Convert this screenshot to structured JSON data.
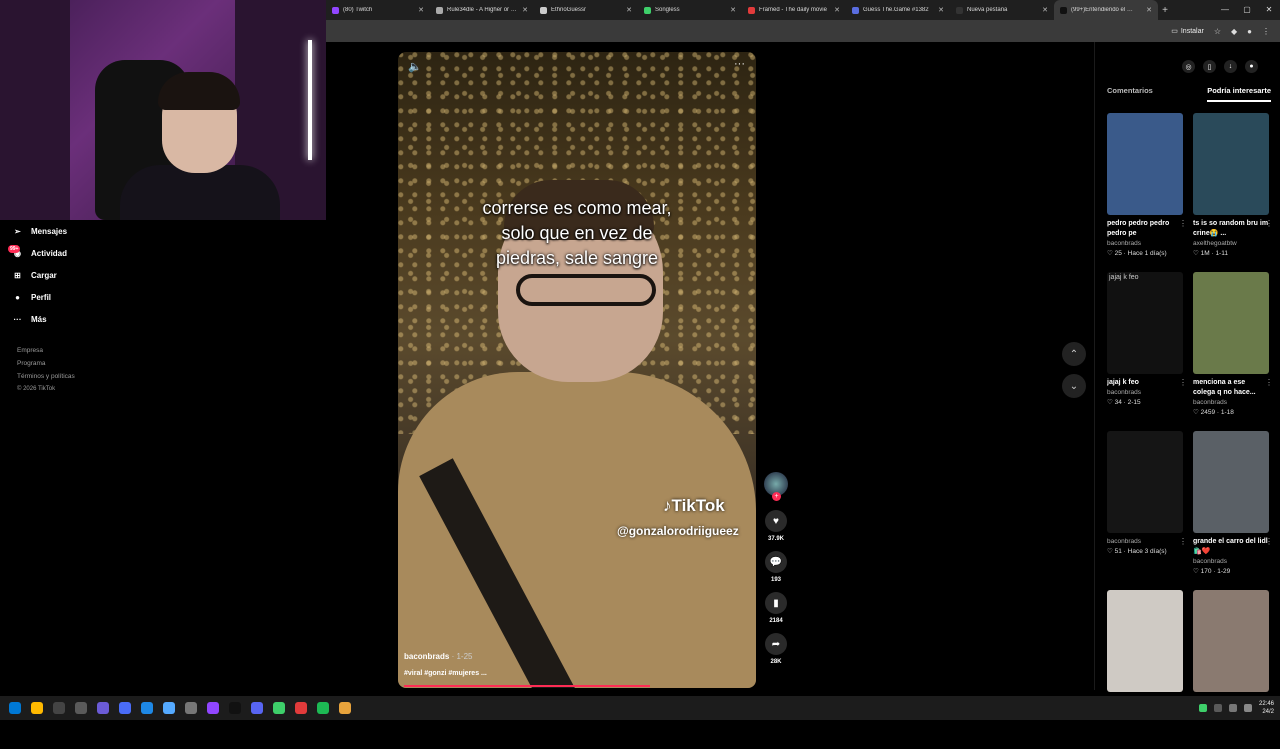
{
  "browser": {
    "tabs": [
      {
        "title": "(80) Twitch",
        "color": "#9146ff",
        "active": false
      },
      {
        "title": "Rule34dle - A Higher or Lower",
        "color": "#aaaaaa",
        "active": false
      },
      {
        "title": "EthnoGuessr",
        "color": "#cccccc",
        "active": false
      },
      {
        "title": "Songless",
        "color": "#3ecf6a",
        "active": false
      },
      {
        "title": "Framed - The daily movie",
        "color": "#e23b3b",
        "active": false
      },
      {
        "title": "Guess The.Game #1382",
        "color": "#5a6de0",
        "active": false
      },
      {
        "title": "Nueva pestaña",
        "color": "#333333",
        "active": false
      },
      {
        "title": "(99+)Entendiendo el …",
        "color": "#111111",
        "active": true
      }
    ],
    "new_tab": "+",
    "install_label": "Instalar"
  },
  "sidebar": {
    "items": [
      {
        "label": "Mensajes",
        "icon": "send-icon"
      },
      {
        "label": "Actividad",
        "icon": "bell-icon",
        "badge": "99+"
      },
      {
        "label": "Cargar",
        "icon": "plus-box-icon"
      },
      {
        "label": "Perfil",
        "icon": "avatar-icon"
      },
      {
        "label": "Más",
        "icon": "more-icon"
      }
    ],
    "footer": [
      "Empresa",
      "Programa",
      "Términos y políticas"
    ],
    "copyright": "© 2026 TikTok"
  },
  "video": {
    "caption_lines": [
      "correrse es como mear,",
      "solo que en vez de",
      "piedras, sale sangre"
    ],
    "watermark_logo": "TikTok",
    "watermark_user": "@gonzalorodriigueez",
    "author": "baconbrads",
    "date": "· 1-25",
    "tags": "#viral #gonzi #mujeres ...",
    "likes": "37.9K",
    "comments": "193",
    "saves": "2184",
    "shares": "28K"
  },
  "panel": {
    "tabs": [
      "Comentarios",
      "Podría interesarte"
    ],
    "cards": [
      {
        "title": "pedro pedro pedro pedro pe",
        "author": "baconbrads",
        "stats": "♡ 25 · Hace 1 día(s)",
        "color": "#3a5a8a",
        "alt": ""
      },
      {
        "title": "ts is so random bru im crine😭 ...",
        "author": "axelthegoatbtw",
        "stats": "♡ 1M · 1-11",
        "color": "#2a4a5a",
        "alt": ""
      },
      {
        "title": "jajaj k feo",
        "author": "baconbrads",
        "stats": "♡ 34 · 2-15",
        "color": "#111111",
        "alt": "jajaj k feo"
      },
      {
        "title": "menciona a ese colega q no hace...",
        "author": "baconbrads",
        "stats": "♡ 2459 · 1-18",
        "color": "#6a7a4a",
        "alt": ""
      },
      {
        "title": "",
        "author": "baconbrads",
        "stats": "♡ 51 · Hace 3 día(s)",
        "color": "#151515",
        "alt": ""
      },
      {
        "title": "grande el carro del lidl🛍️❤️",
        "author": "baconbrads",
        "stats": "♡ 170 · 1-29",
        "color": "#5a6066",
        "alt": ""
      },
      {
        "title": "",
        "author": "",
        "stats": "",
        "color": "#cfcac4",
        "alt": ""
      },
      {
        "title": "",
        "author": "",
        "stats": "",
        "color": "#8a7a70",
        "alt": ""
      }
    ]
  },
  "taskbar": {
    "apps": [
      "#0078d4",
      "#ffb900",
      "#444444",
      "#5a5a5a",
      "#6b5bd6",
      "#4a6cf7",
      "#1e88e5",
      "#55aaff",
      "#777777",
      "#9146ff",
      "#111111",
      "#5865f2",
      "#3ecf6a",
      "#e23b3b",
      "#1db954",
      "#e8a33c"
    ],
    "time": "22:46",
    "date": "24/2"
  }
}
